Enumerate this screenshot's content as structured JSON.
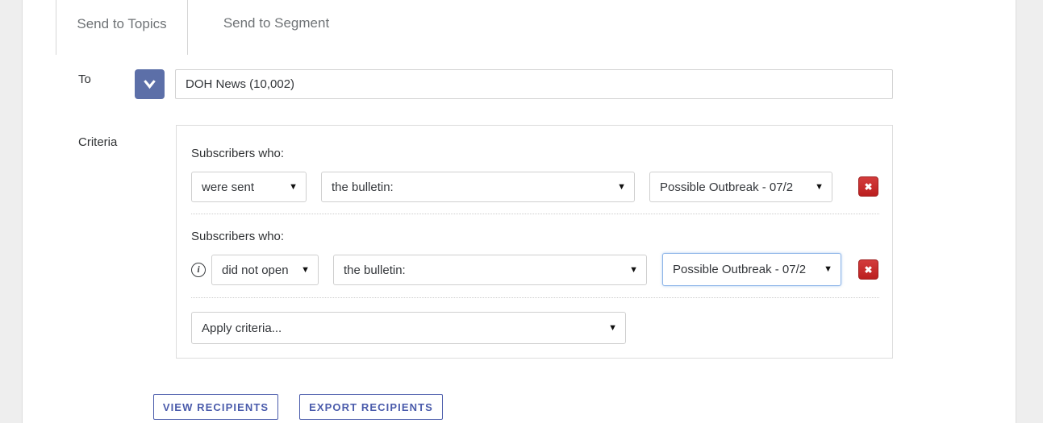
{
  "tabs": [
    {
      "label": "Send to Topics",
      "active": true
    },
    {
      "label": "Send to Segment",
      "active": false
    }
  ],
  "form": {
    "to_label": "To",
    "to_value": "DOH News (10,002)",
    "to_toggle_icon": "chevron-down-icon",
    "criteria_label": "Criteria"
  },
  "criteria": {
    "rows": [
      {
        "heading": "Subscribers who:",
        "has_info_icon": false,
        "action": "were sent",
        "object": "the bulletin:",
        "target": "Possible Outbreak - 07/2",
        "target_focused": false,
        "remove_label": "✖"
      },
      {
        "heading": "Subscribers who:",
        "has_info_icon": true,
        "info_icon_glyph": "i",
        "action": "did not open",
        "object": "the bulletin:",
        "target": "Possible Outbreak - 07/2",
        "target_focused": true,
        "remove_label": "✖"
      }
    ],
    "apply_placeholder": "Apply criteria...",
    "caret_glyph": "▼"
  },
  "footer": {
    "view_recipients": "VIEW RECIPIENTS",
    "export_recipients": "EXPORT RECIPIENTS"
  },
  "colors": {
    "accent_blue": "#4a5bab",
    "toggle_blue": "#5c6fa8",
    "danger_red": "#bb1f1f",
    "page_bg": "#eeeeee",
    "focus_blue": "#8cb4e8"
  }
}
